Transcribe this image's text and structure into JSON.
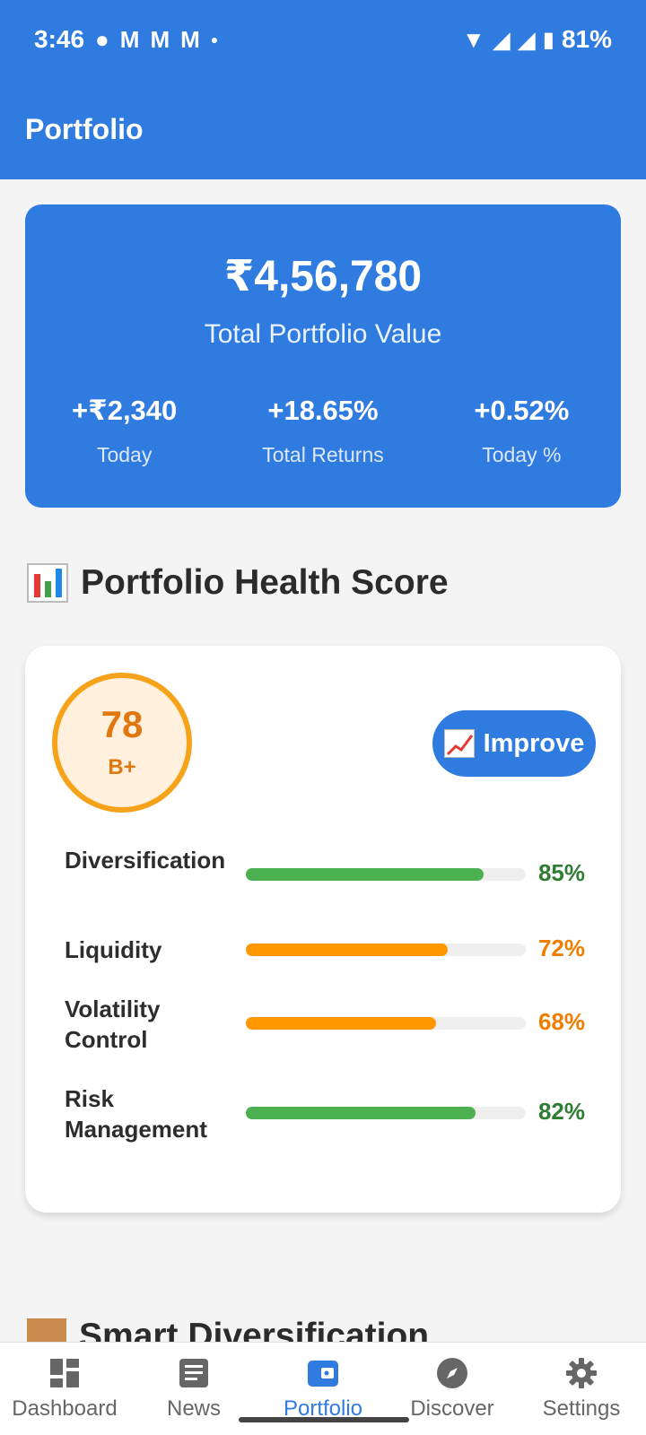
{
  "status_bar": {
    "time": "3:46",
    "battery": "81%",
    "notification_icons": [
      "chat-bubble-icon",
      "gmail-icon",
      "gmail-icon",
      "gmail-icon",
      "dot-icon"
    ],
    "system_icons": [
      "wifi-icon",
      "signal-icon",
      "signal-icon",
      "battery-icon"
    ]
  },
  "app_bar": {
    "title": "Portfolio"
  },
  "summary": {
    "total_value": "₹4,56,780",
    "total_label": "Total Portfolio Value",
    "stats": [
      {
        "value": "+₹2,340",
        "label": "Today"
      },
      {
        "value": "+18.65%",
        "label": "Total Returns"
      },
      {
        "value": "+0.52%",
        "label": "Today %"
      }
    ]
  },
  "health_section": {
    "title": "Portfolio Health Score",
    "score": "78",
    "grade": "B+",
    "improve_label": "Improve",
    "metrics": [
      {
        "label": "Diversification",
        "value": "85%",
        "percent": 85,
        "color": "#4caf50",
        "text_color": "#2e7d32"
      },
      {
        "label": "Liquidity",
        "value": "72%",
        "percent": 72,
        "color": "#ff9800",
        "text_color": "#ef7d00"
      },
      {
        "label": "Volatility Control",
        "value": "68%",
        "percent": 68,
        "color": "#ff9800",
        "text_color": "#ef7d00"
      },
      {
        "label": "Risk Management",
        "value": "82%",
        "percent": 82,
        "color": "#4caf50",
        "text_color": "#2e7d32"
      }
    ]
  },
  "next_section": {
    "title": "Smart Diversification"
  },
  "bottom_nav": {
    "items": [
      {
        "label": "Dashboard",
        "icon": "dashboard-icon",
        "active": false
      },
      {
        "label": "News",
        "icon": "news-icon",
        "active": false
      },
      {
        "label": "Portfolio",
        "icon": "wallet-icon",
        "active": true
      },
      {
        "label": "Discover",
        "icon": "compass-icon",
        "active": false
      },
      {
        "label": "Settings",
        "icon": "gear-icon",
        "active": false
      }
    ]
  },
  "colors": {
    "primary": "#2f7be0",
    "warning": "#ff9800",
    "success": "#4caf50",
    "score_text": "#e07812"
  }
}
